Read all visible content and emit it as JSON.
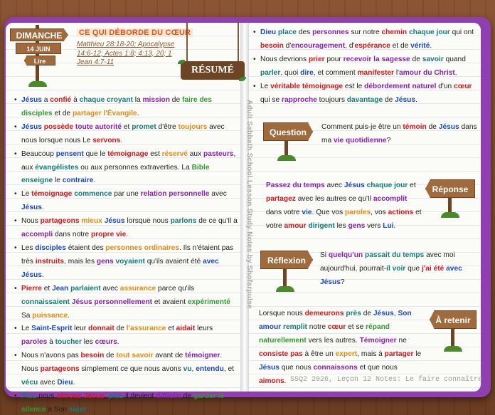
{
  "header": {
    "day": "DIMANCHE",
    "date": "14 JUIN",
    "read": "Lire",
    "title": "CE QUI DÉBORDE DU CŒUR",
    "references": [
      "Matthieu 28:18-20; Apocalypse",
      "14:6-12; Actes 1:8; 4:13, 20; 1",
      "Jean 4:7-11"
    ],
    "summary_sign": "RÉSUMÉ"
  },
  "left_bullets": [
    [
      [
        "Jésus",
        "blue"
      ],
      [
        " a "
      ],
      [
        "confié",
        "red"
      ],
      [
        " à "
      ],
      [
        "chaque croyant",
        "teal"
      ],
      [
        " la "
      ],
      [
        "mission",
        "purple"
      ],
      [
        " de "
      ],
      [
        "faire des disciples",
        "green"
      ],
      [
        " et de "
      ],
      [
        "partager l'Évangile",
        "orange"
      ],
      [
        "."
      ]
    ],
    [
      [
        "Jésus",
        "blue"
      ],
      [
        " "
      ],
      [
        "possède",
        "red"
      ],
      [
        " "
      ],
      [
        "toute autorité",
        "purple"
      ],
      [
        " et "
      ],
      [
        "promet",
        "teal"
      ],
      [
        " d'être "
      ],
      [
        "toujours",
        "orange"
      ],
      [
        " avec nous lorsque nous Le "
      ],
      [
        "servons",
        "red"
      ],
      [
        "."
      ]
    ],
    [
      [
        "Beaucoup "
      ],
      [
        "pensent",
        "blue"
      ],
      [
        " que le "
      ],
      [
        "témoignage",
        "red"
      ],
      [
        " est "
      ],
      [
        "réservé",
        "orange"
      ],
      [
        " aux "
      ],
      [
        "pasteurs",
        "purple"
      ],
      [
        ", aux "
      ],
      [
        "évangélistes",
        "teal"
      ],
      [
        " ou aux personnes extraverties. La "
      ],
      [
        "Bible",
        "green"
      ],
      [
        " "
      ],
      [
        "enseigne",
        "teal"
      ],
      [
        " le "
      ],
      [
        "contraire",
        "blue"
      ],
      [
        "."
      ]
    ],
    [
      [
        "Le "
      ],
      [
        "témoignage",
        "red"
      ],
      [
        " "
      ],
      [
        "commence",
        "teal"
      ],
      [
        " par une "
      ],
      [
        "relation personnelle",
        "purple"
      ],
      [
        " avec "
      ],
      [
        "Jésus",
        "blue"
      ],
      [
        "."
      ]
    ],
    [
      [
        "Nous "
      ],
      [
        "partageons",
        "red"
      ],
      [
        " "
      ],
      [
        "mieux",
        "orange"
      ],
      [
        " "
      ],
      [
        "Jésus",
        "blue"
      ],
      [
        " lorsque nous "
      ],
      [
        "parlons",
        "teal"
      ],
      [
        " de ce qu'Il a "
      ],
      [
        "accompli",
        "purple"
      ],
      [
        " dans notre "
      ],
      [
        "propre vie",
        "red"
      ],
      [
        "."
      ]
    ],
    [
      [
        "Les "
      ],
      [
        "disciples",
        "blue"
      ],
      [
        " étaient des "
      ],
      [
        "personnes ordinaires",
        "orange"
      ],
      [
        ". Ils n'étaient pas très "
      ],
      [
        "instruits",
        "red"
      ],
      [
        ", mais les "
      ],
      [
        "gens",
        "purple"
      ],
      [
        " "
      ],
      [
        "voyaient",
        "teal"
      ],
      [
        " qu'ils avaient été "
      ],
      [
        "avec Jésus",
        "blue"
      ],
      [
        "."
      ]
    ],
    [
      [
        "Pierre",
        "red"
      ],
      [
        " et "
      ],
      [
        "Jean",
        "blue"
      ],
      [
        " "
      ],
      [
        "parlaient",
        "teal"
      ],
      [
        " avec "
      ],
      [
        "assurance",
        "orange"
      ],
      [
        " parce qu'ils "
      ],
      [
        "connaissaient",
        "teal"
      ],
      [
        " "
      ],
      [
        "Jésus personnellement",
        "purple"
      ],
      [
        " et avaient "
      ],
      [
        "expérimenté",
        "green"
      ],
      [
        " Sa "
      ],
      [
        "puissance",
        "orange"
      ],
      [
        "."
      ]
    ],
    [
      [
        "Le "
      ],
      [
        "Saint-Esprit",
        "blue"
      ],
      [
        " leur "
      ],
      [
        "donnait",
        "red"
      ],
      [
        " de "
      ],
      [
        "l'assurance",
        "orange"
      ],
      [
        " et "
      ],
      [
        "aidait",
        "red"
      ],
      [
        " leurs "
      ],
      [
        "paroles",
        "purple"
      ],
      [
        " à "
      ],
      [
        "toucher",
        "teal"
      ],
      [
        " les "
      ],
      [
        "cœurs",
        "purple"
      ],
      [
        "."
      ]
    ],
    [
      [
        "Nous n'avons pas "
      ],
      [
        "besoin",
        "red"
      ],
      [
        " de "
      ],
      [
        "tout savoir",
        "orange"
      ],
      [
        " avant de "
      ],
      [
        "témoigner",
        "purple"
      ],
      [
        ". Nous "
      ],
      [
        "partageons",
        "red"
      ],
      [
        " simplement ce que nous avons "
      ],
      [
        "vu",
        "teal"
      ],
      [
        ", "
      ],
      [
        "entendu",
        "blue"
      ],
      [
        ", et "
      ],
      [
        "vécu",
        "teal"
      ],
      [
        " avec "
      ],
      [
        "Dieu",
        "blue"
      ],
      [
        "."
      ]
    ],
    [
      [
        "Plus",
        "teal"
      ],
      [
        " nous "
      ],
      [
        "aimons Jésus",
        "red"
      ],
      [
        ", "
      ],
      [
        "plus",
        "teal"
      ],
      [
        " il devient "
      ],
      [
        "difficile",
        "purple"
      ],
      [
        " de "
      ],
      [
        "garder le silence",
        "green"
      ],
      [
        " à Son "
      ],
      [
        "sujet",
        "teal"
      ],
      [
        "."
      ]
    ]
  ],
  "right_bullets": [
    [
      [
        "Dieu",
        "blue"
      ],
      [
        " "
      ],
      [
        "place",
        "teal"
      ],
      [
        " des "
      ],
      [
        "personnes",
        "purple"
      ],
      [
        " sur notre "
      ],
      [
        "chemin",
        "red"
      ],
      [
        " "
      ],
      [
        "chaque jour",
        "teal"
      ],
      [
        " qui ont "
      ],
      [
        "besoin",
        "red"
      ],
      [
        " d'"
      ],
      [
        "encouragement",
        "purple"
      ],
      [
        ", d'"
      ],
      [
        "espérance",
        "red"
      ],
      [
        " et de "
      ],
      [
        "vérité",
        "blue"
      ],
      [
        "."
      ]
    ],
    [
      [
        "Nous devrions "
      ],
      [
        "prier",
        "red"
      ],
      [
        " pour "
      ],
      [
        "recevoir la sagesse",
        "purple"
      ],
      [
        " de "
      ],
      [
        "savoir",
        "teal"
      ],
      [
        " quand "
      ],
      [
        "parler",
        "teal"
      ],
      [
        ", quoi "
      ],
      [
        "dire",
        "blue"
      ],
      [
        ", et comment "
      ],
      [
        "manifester",
        "red"
      ],
      [
        " l'"
      ],
      [
        "amour du Christ",
        "purple"
      ],
      [
        "."
      ]
    ],
    [
      [
        "Le "
      ],
      [
        "véritable témoignage",
        "red"
      ],
      [
        " est le "
      ],
      [
        "débordement naturel",
        "purple"
      ],
      [
        " d'un "
      ],
      [
        "cœur",
        "red"
      ],
      [
        " qui se "
      ],
      [
        "rapproche",
        "purple"
      ],
      [
        " toujours "
      ],
      [
        "davantage",
        "teal"
      ],
      [
        " de "
      ],
      [
        "Jésus",
        "blue"
      ],
      [
        "."
      ]
    ]
  ],
  "question": {
    "sign": "Question",
    "text": [
      [
        "Comment puis-je être un "
      ],
      [
        "témoin",
        "red"
      ],
      [
        " de "
      ],
      [
        "Jésus",
        "blue"
      ],
      [
        " dans ma "
      ],
      [
        "vie quotidienne",
        "purple"
      ],
      [
        "?"
      ]
    ]
  },
  "response": {
    "sign": "Réponse",
    "text": [
      [
        "Passez du temps",
        "purple"
      ],
      [
        " avec "
      ],
      [
        "Jésus",
        "blue"
      ],
      [
        " "
      ],
      [
        "chaque jour",
        "teal"
      ],
      [
        " et "
      ],
      [
        "partagez",
        "red"
      ],
      [
        " avec les autres ce qu'Il "
      ],
      [
        "accomplit",
        "purple"
      ],
      [
        " dans votre "
      ],
      [
        "vie",
        "blue"
      ],
      [
        ". Que vos "
      ],
      [
        "paroles",
        "orange"
      ],
      [
        ", vos "
      ],
      [
        "actions",
        "red"
      ],
      [
        " et votre "
      ],
      [
        "amour",
        "red"
      ],
      [
        " "
      ],
      [
        "dirigent",
        "teal"
      ],
      [
        " les "
      ],
      [
        "gens",
        "purple"
      ],
      [
        " vers "
      ],
      [
        "Lui",
        "blue"
      ],
      [
        "."
      ]
    ]
  },
  "reflection": {
    "sign": "Réflexion",
    "text": [
      [
        "Si "
      ],
      [
        "quelqu'un",
        "purple"
      ],
      [
        " "
      ],
      [
        "passait du temps",
        "teal"
      ],
      [
        " avec moi aujourd'hui, pourrait-"
      ],
      [
        "il voir",
        "teal"
      ],
      [
        " que "
      ],
      [
        "j'ai été",
        "red"
      ],
      [
        " "
      ],
      [
        "avec Jésus",
        "blue"
      ],
      [
        "?"
      ]
    ]
  },
  "retain": {
    "sign": "À retenir",
    "text": [
      [
        "Lorsque nous "
      ],
      [
        "demeurons",
        "red"
      ],
      [
        " "
      ],
      [
        "près",
        "teal"
      ],
      [
        " de "
      ],
      [
        "Jésus",
        "blue"
      ],
      [
        ", "
      ],
      [
        "Son amour",
        "blue"
      ],
      [
        " "
      ],
      [
        "remplit",
        "teal"
      ],
      [
        " notre "
      ],
      [
        "cœur",
        "red"
      ],
      [
        " et se "
      ],
      [
        "répand naturellement",
        "green"
      ],
      [
        " vers les autres. "
      ],
      [
        "Témoigner",
        "purple"
      ],
      [
        " ne "
      ],
      [
        "consiste pas",
        "red"
      ],
      [
        " à être un "
      ],
      [
        "expert",
        "orange"
      ],
      [
        ", mais à "
      ],
      [
        "partager",
        "red"
      ],
      [
        " le "
      ],
      [
        "Jésus",
        "blue"
      ],
      [
        " que nous "
      ],
      [
        "connaissons",
        "purple"
      ],
      [
        " et que nous "
      ],
      [
        "aimons",
        "red"
      ],
      [
        "."
      ]
    ]
  },
  "vertical_credit": "Adult Sabbath School Lesson Study Notes by Shofarpulse",
  "footer": "SSQ2 2026, Leçon 12 Notes: Le faire connaître",
  "colors": {
    "blue": "#1a49c8",
    "red": "#d4151c",
    "green": "#2f9a2f",
    "orange": "#e38b12",
    "purple": "#8a1fb0",
    "teal": "#137c78",
    "wood": "#a06b3c",
    "cover": "#8f3fb0"
  }
}
